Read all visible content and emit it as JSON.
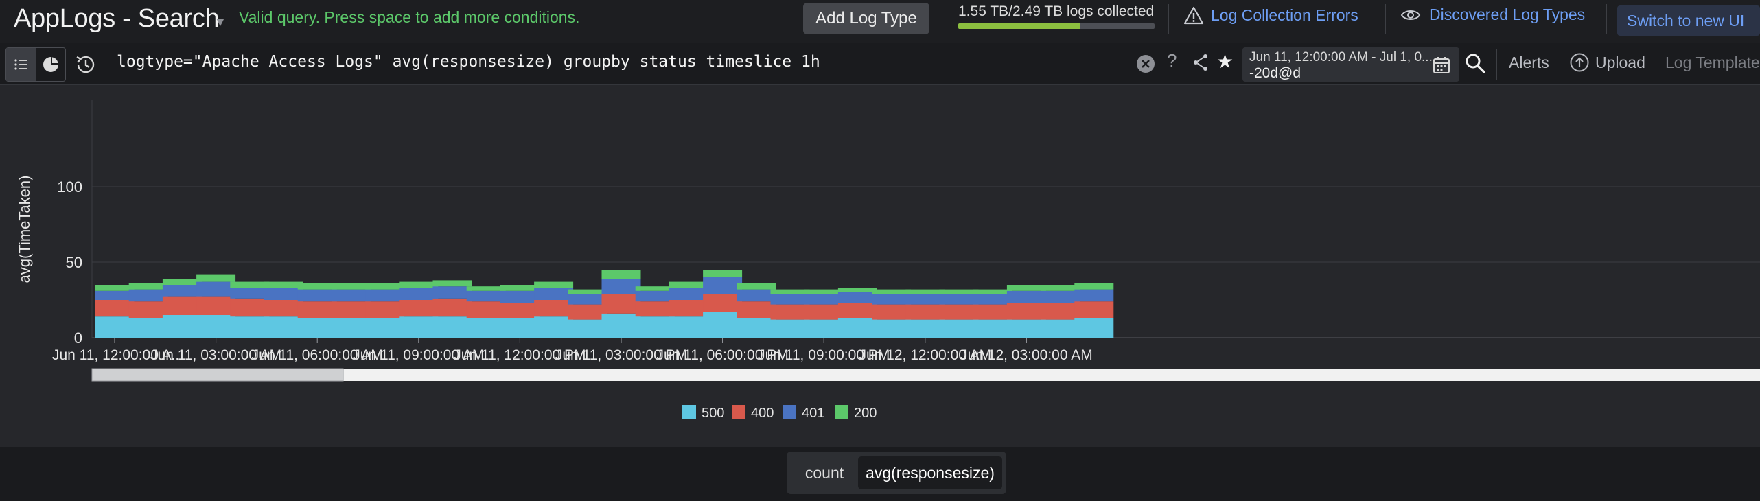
{
  "header": {
    "title": "AppLogs - Search",
    "query_status": "Valid query. Press space to add more conditions.",
    "add_log_type_label": "Add Log Type",
    "storage": {
      "text": "1.55 TB/2.49 TB logs collected",
      "used_fraction": 0.62
    },
    "errors_label": "Log Collection Errors",
    "discovered_label": "Discovered Log Types",
    "switch_label": "Switch to new UI"
  },
  "querybar": {
    "query": "logtype=\"Apache Access Logs\" avg(responsesize) groupby status timeslice 1h",
    "help": "?",
    "star": "★",
    "daterange_top": "Jun 11, 12:00:00 AM - Jul 1, 0...",
    "daterange_bottom": "-20d@d",
    "alerts_label": "Alerts",
    "upload_label": "Upload",
    "templates_label": "Log Template"
  },
  "icons": {
    "view_list": "list-icon",
    "view_chart": "pie-chart-icon",
    "history": "history-icon",
    "clear": "clear-icon",
    "share": "share-icon",
    "calendar": "calendar-icon",
    "search": "search-icon",
    "upload": "upload-icon",
    "warning": "warning-icon",
    "eye": "eye-icon"
  },
  "chart_data": {
    "type": "bar",
    "stacked": true,
    "ylabel": "avg(TimeTaken)",
    "ylim": [
      0,
      135
    ],
    "yticks": [
      0,
      50,
      100
    ],
    "grid": true,
    "legend_position": "bottom-center",
    "x_tick_labels": [
      "Jun 11, 12:00:00 A..",
      "Jun 11, 03:00:00 AM",
      "Jun 11, 06:00:00 AM",
      "Jun 11, 09:00:00 AM",
      "Jun 11, 12:00:00 PM",
      "Jun 11, 03:00:00 PM",
      "Jun 11, 06:00:00 PM",
      "Jun 11, 09:00:00 PM",
      "Jun 12, 12:00:00 AM",
      "Jun 12, 03:00:00 AM"
    ],
    "x_tick_every": 3,
    "series": [
      {
        "name": "500",
        "color": "#5ec7e2",
        "values": [
          14,
          13,
          15,
          15,
          14,
          14,
          13,
          13,
          13,
          14,
          14,
          13,
          13,
          14,
          12,
          16,
          14,
          14,
          17,
          13,
          12,
          12,
          13,
          12,
          12,
          12,
          12,
          12,
          12,
          13
        ]
      },
      {
        "name": "400",
        "color": "#d8594c",
        "values": [
          11,
          11,
          12,
          12,
          12,
          11,
          11,
          11,
          11,
          11,
          12,
          11,
          10,
          11,
          10,
          13,
          10,
          11,
          12,
          11,
          10,
          10,
          10,
          10,
          10,
          10,
          10,
          11,
          11,
          11
        ]
      },
      {
        "name": "401",
        "color": "#4a73c2",
        "values": [
          6,
          8,
          8,
          10,
          7,
          8,
          8,
          8,
          8,
          8,
          8,
          7,
          8,
          8,
          7,
          10,
          7,
          8,
          11,
          8,
          7,
          7,
          7,
          7,
          7,
          7,
          7,
          8,
          8,
          8
        ]
      },
      {
        "name": "200",
        "color": "#5cc86a",
        "values": [
          4,
          4,
          4,
          5,
          4,
          4,
          4,
          4,
          4,
          4,
          4,
          3,
          4,
          4,
          3,
          6,
          3,
          4,
          5,
          4,
          3,
          3,
          3,
          3,
          3,
          3,
          3,
          4,
          4,
          4
        ]
      }
    ]
  },
  "metrics": {
    "count_label": "count",
    "avg_label": "avg(responsesize)"
  }
}
